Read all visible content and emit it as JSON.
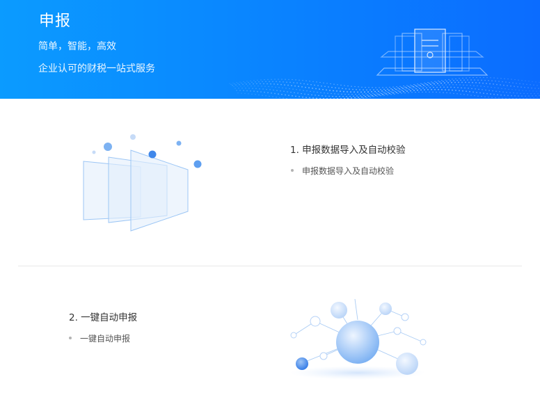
{
  "banner": {
    "title": "申报",
    "subtitle_1": "简单，智能，高效",
    "subtitle_2": "企业认可的财税一站式服务"
  },
  "features": [
    {
      "title": "1. 申报数据导入及自动校验",
      "bullet": "申报数据导入及自动校验",
      "icon": "layered-documents-illustration"
    },
    {
      "title": "2. 一键自动申报",
      "bullet": "一键自动申报",
      "icon": "network-nodes-illustration"
    }
  ],
  "colors": {
    "banner_start": "#0b9bff",
    "banner_end": "#0b6cff",
    "accent": "#3d8ef0",
    "text": "#333333",
    "divider": "#e8e8e8"
  }
}
